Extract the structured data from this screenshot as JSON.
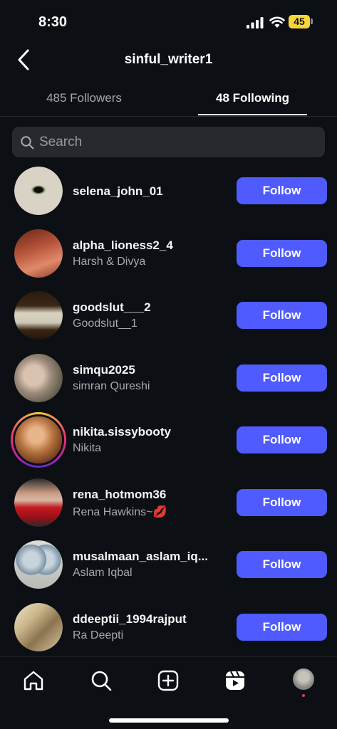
{
  "status_bar": {
    "time": "8:30",
    "battery": "45",
    "battery_color": "#f5d63a"
  },
  "header": {
    "title": "sinful_writer1"
  },
  "tabs": [
    {
      "label": "485 Followers",
      "active": false
    },
    {
      "label": "48 Following",
      "active": true
    }
  ],
  "search": {
    "placeholder": "Search",
    "value": ""
  },
  "accounts": [
    {
      "username": "selena_john_01",
      "full_name": "",
      "button": "Follow",
      "avatar": "eye-artwork"
    },
    {
      "username": "alpha_lioness2_4",
      "full_name": "Harsh & Divya",
      "button": "Follow",
      "avatar": "couple-photo"
    },
    {
      "username": "goodslut___2",
      "full_name": "Goodslut__1",
      "button": "Follow",
      "avatar": "note-photo"
    },
    {
      "username": "simqu2025",
      "full_name": "simran Qureshi",
      "button": "Follow",
      "avatar": "portrait-photo"
    },
    {
      "username": "nikita.sissybooty",
      "full_name": "Nikita",
      "button": "Follow",
      "avatar": "portrait-photo",
      "has_story": true
    },
    {
      "username": "rena_hotmom36",
      "full_name": "Rena Hawkins~💋",
      "button": "Follow",
      "avatar": "portrait-photo"
    },
    {
      "username": "musalmaan_aslam_iq...",
      "full_name": "Aslam Iqbal",
      "button": "Follow",
      "avatar": "masks-photo"
    },
    {
      "username": "ddeeptii_1994rajput",
      "full_name": "Ra Deepti",
      "button": "Follow",
      "avatar": "portrait-photo"
    }
  ],
  "bottom_nav": [
    {
      "name": "home-icon"
    },
    {
      "name": "search-icon"
    },
    {
      "name": "create-icon"
    },
    {
      "name": "reels-icon"
    },
    {
      "name": "profile-avatar",
      "notification_dot": true
    }
  ],
  "colors": {
    "background": "#0c1014",
    "follow_button": "#4f5bff",
    "secondary_text": "#a8a8a8",
    "search_bg": "#262a2f"
  }
}
